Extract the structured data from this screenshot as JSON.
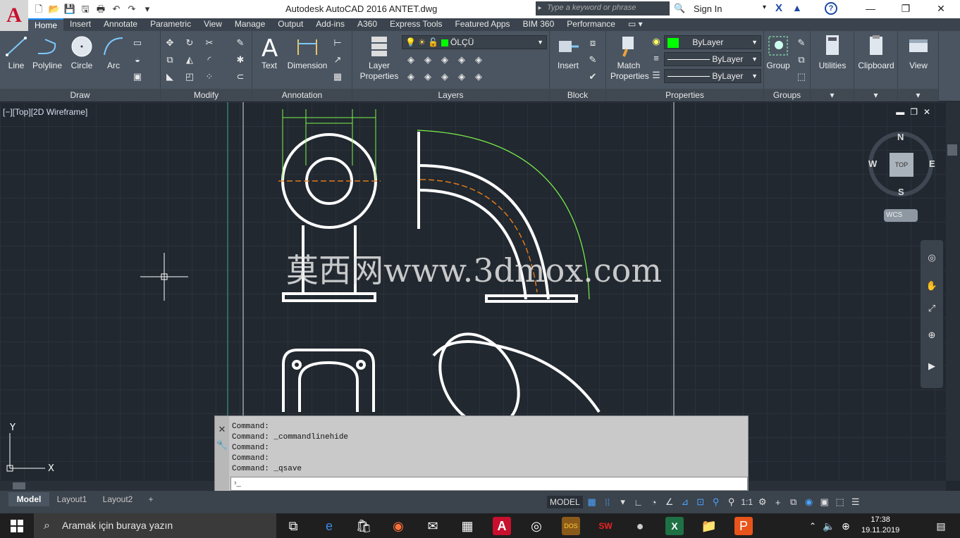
{
  "window": {
    "title": "Autodesk AutoCAD 2016    ANTET.dwg",
    "search_placeholder": "Type a keyword or phrase",
    "sign_in": "Sign In"
  },
  "tabs": [
    "Home",
    "Insert",
    "Annotate",
    "Parametric",
    "View",
    "Manage",
    "Output",
    "Add-ins",
    "A360",
    "Express Tools",
    "Featured Apps",
    "BIM 360",
    "Performance"
  ],
  "panels": {
    "draw": {
      "title": "Draw",
      "tools": [
        "Line",
        "Polyline",
        "Circle",
        "Arc"
      ]
    },
    "modify": {
      "title": "Modify"
    },
    "annotation": {
      "title": "Annotation",
      "tools": [
        "Text",
        "Dimension"
      ]
    },
    "layers": {
      "title": "Layers",
      "layer_properties": "Layer Properties",
      "current_layer": "ÖLÇÜ"
    },
    "block": {
      "title": "Block",
      "insert": "Insert"
    },
    "properties": {
      "title": "Properties",
      "match": "Match Properties",
      "color": "ByLayer",
      "linetype": "ByLayer",
      "lineweight": "ByLayer"
    },
    "groups": {
      "title": "Groups",
      "group": "Group"
    },
    "utilities": "Utilities",
    "clipboard": "Clipboard",
    "view": "View"
  },
  "viewport": {
    "label": "[−][Top][2D Wireframe]",
    "watermark": "莫西网www.3dmox.com",
    "viewcube": {
      "top": "TOP",
      "n": "N",
      "s": "S",
      "e": "E",
      "w": "W",
      "wcs": "WCS"
    }
  },
  "command": {
    "history": [
      "Command:",
      "Command: _commandlinehide",
      "Command:",
      "Command:",
      "Command: _qsave"
    ],
    "prompt": "›_"
  },
  "layouts": [
    "Model",
    "Layout1",
    "Layout2"
  ],
  "status": {
    "model": "MODEL",
    "scale": "1:1"
  },
  "taskbar": {
    "search": "Aramak için buraya yazın",
    "time": "17:38",
    "date": "19.11.2019"
  }
}
